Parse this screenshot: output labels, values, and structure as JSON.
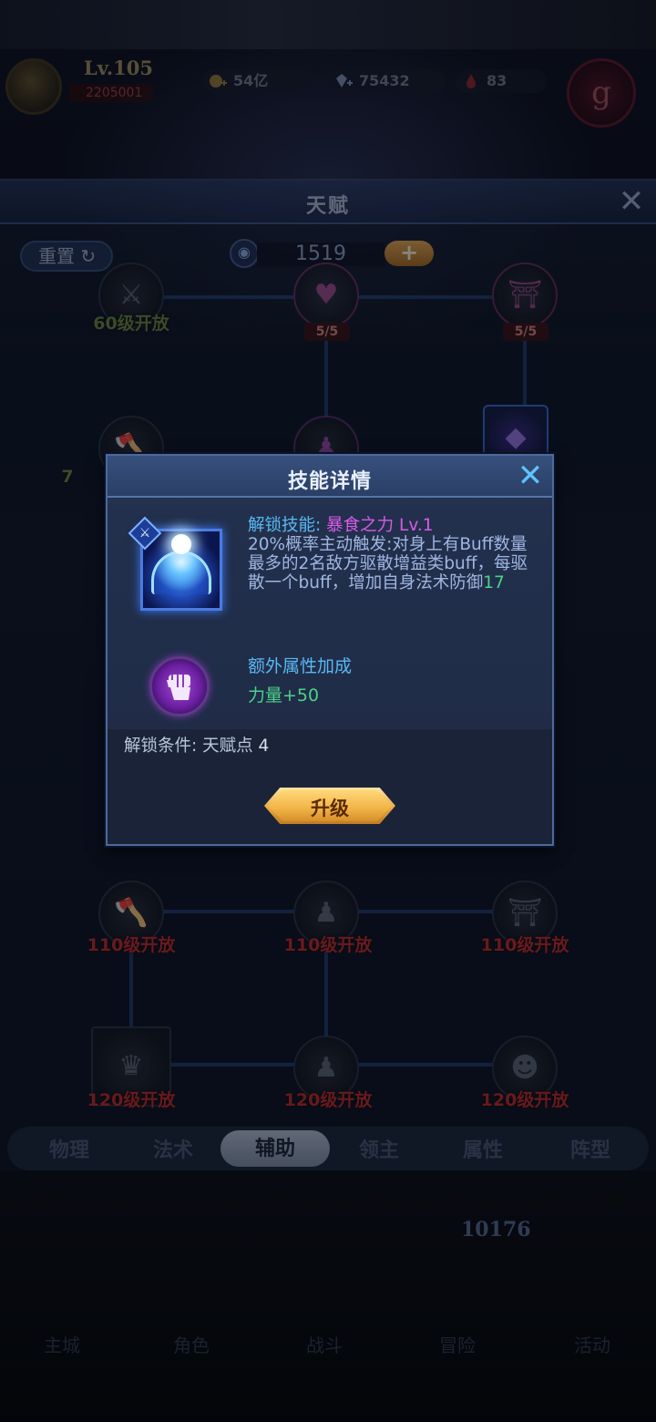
{
  "header": {
    "level": "Lv.105",
    "power": "2205001",
    "gold": "54亿",
    "gems": "75432",
    "blood": "83",
    "emblem": "g"
  },
  "panel": {
    "title": "天赋",
    "reset_label": "重置",
    "points": "1519",
    "plus_label": "+",
    "rows": [
      {
        "req": "60级开放",
        "left_frac": "",
        "mid_frac": "5/5",
        "right_frac": "5/5"
      },
      {
        "req_left": "110级开放",
        "req_mid": "110级开放",
        "req_right": "110级开放"
      },
      {
        "req_left": "120级开放",
        "req_mid": "120级开放",
        "req_right": "120级开放"
      }
    ],
    "partial_left": "7"
  },
  "tabs": [
    "物理",
    "法术",
    "辅助",
    "领主",
    "属性",
    "阵型"
  ],
  "active_tab": "辅助",
  "bottom": {
    "stat": "10176"
  },
  "nav": [
    "主城",
    "角色",
    "战斗",
    "冒险",
    "活动"
  ],
  "modal": {
    "title": "技能详情",
    "unlock_skill_label": "解锁技能: ",
    "skill_name": "暴食之力 Lv.1",
    "skill_desc": "20%概率主动触发:对身上有Buff数量最多的2名敌方驱散增益类buff，每驱散一个buff，增加自身法术防御",
    "skill_value": "17",
    "extra_title": "额外属性加成",
    "extra_value": "力量+50",
    "unlock_condition_label": "解锁条件: 天赋点 ",
    "unlock_condition_value": "4",
    "upgrade_label": "升级"
  },
  "colors": {
    "skill_name": "#d95ae8",
    "label_blue": "#59b8f2",
    "value_green": "#4bd28a",
    "locked_red": "#c72a2a",
    "upgrade_gold": "#f1b345"
  },
  "icons": {
    "close": "close-icon",
    "reset": "refresh-icon",
    "points": "eye-shield-icon",
    "skill": "shield-dome-skill-icon",
    "extra": "fist-icon"
  }
}
